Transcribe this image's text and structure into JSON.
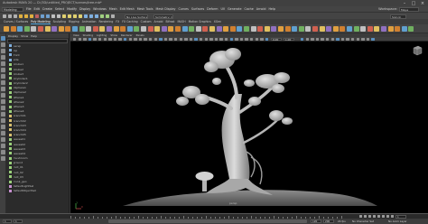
{
  "titlebar": {
    "title": "Autodesk MAYA 20 — D:/3D/untitled_PROJECT/scenes/tree.mb*",
    "minimize": "–",
    "maximize": "□",
    "close": "×"
  },
  "menubar": {
    "mode": "Modeling",
    "items": [
      "File",
      "Edit",
      "Create",
      "Select",
      "Modify",
      "Display",
      "Windows",
      "Mesh",
      "Edit Mesh",
      "Mesh Tools",
      "Mesh Display",
      "Curves",
      "Surfaces",
      "Deform",
      "UV",
      "Generate",
      "Cache",
      "Arnold",
      "Help"
    ],
    "workspace_label": "Workspace:",
    "workspace_value": "Maya Classic"
  },
  "statusline": {
    "object_selector": "No Live Surface",
    "symmetry": "Symmetry: Off",
    "live": "Sign In"
  },
  "shelf_tabs": [
    "Curves / Surfaces",
    "Poly Modeling",
    "Sculpting",
    "Rigging",
    "Animation",
    "Rendering",
    "FX",
    "FX Caching",
    "Custom",
    "Arnold",
    "Bifrost",
    "MASH",
    "Motion Graphics",
    "XGen"
  ],
  "shelf_active": 1,
  "outliner": {
    "menu": [
      "Display",
      "Show",
      "Help"
    ],
    "search_placeholder": "Search...",
    "rows": [
      {
        "label": "persp",
        "type": "camera"
      },
      {
        "label": "top",
        "type": "camera"
      },
      {
        "label": "front",
        "type": "camera"
      },
      {
        "label": "side",
        "type": "camera"
      },
      {
        "label": "pCube1",
        "type": "mesh"
      },
      {
        "label": "pCube2",
        "type": "mesh"
      },
      {
        "label": "pCube3",
        "type": "mesh"
      },
      {
        "label": "pCylinder1",
        "type": "mesh"
      },
      {
        "label": "pCylinder2",
        "type": "mesh"
      },
      {
        "label": "pSphere1",
        "type": "mesh"
      },
      {
        "label": "pSphere2",
        "type": "mesh"
      },
      {
        "label": "pPlane1",
        "type": "mesh"
      },
      {
        "label": "pPlane2",
        "type": "mesh"
      },
      {
        "label": "pPlane3",
        "type": "mesh"
      },
      {
        "label": "pPlane4",
        "type": "mesh"
      },
      {
        "label": "branch01",
        "type": "curve"
      },
      {
        "label": "branch02",
        "type": "curve"
      },
      {
        "label": "branch03",
        "type": "curve"
      },
      {
        "label": "branch04",
        "type": "curve"
      },
      {
        "label": "branch05",
        "type": "curve"
      },
      {
        "label": "leaves01",
        "type": "mesh"
      },
      {
        "label": "leaves02",
        "type": "mesh"
      },
      {
        "label": "leaves03",
        "type": "mesh"
      },
      {
        "label": "leaves04",
        "type": "mesh"
      },
      {
        "label": "mushroom",
        "type": "mesh"
      },
      {
        "label": "ground",
        "type": "mesh"
      },
      {
        "label": "root_01",
        "type": "mesh"
      },
      {
        "label": "root_02",
        "type": "mesh"
      },
      {
        "label": "root_03",
        "type": "mesh"
      },
      {
        "label": "trunk_geo",
        "type": "mesh"
      },
      {
        "label": "defaultLightSet",
        "type": "set"
      },
      {
        "label": "defaultObjectSet",
        "type": "set"
      }
    ]
  },
  "viewport": {
    "menu": [
      "View",
      "Shading",
      "Lighting",
      "Show",
      "Renderer",
      "Panels"
    ],
    "field_a": "0.00",
    "field_b": "1.00",
    "camera_label": "persp",
    "cube_face": "FRONT",
    "axis_x": "X",
    "axis_y": "Y"
  },
  "timeline": {
    "current_frame": "1"
  },
  "range": {
    "start": "1",
    "inner_start": "1",
    "inner_end": "120",
    "end": "200",
    "fps": "24 fps",
    "character": "No Character Set",
    "anim_layer": "No Anim Layer"
  },
  "colors": {
    "accent": "#4fa3d9",
    "panel": "#444444",
    "viewport_bg": "#000000",
    "model": "#c9c9c9"
  }
}
